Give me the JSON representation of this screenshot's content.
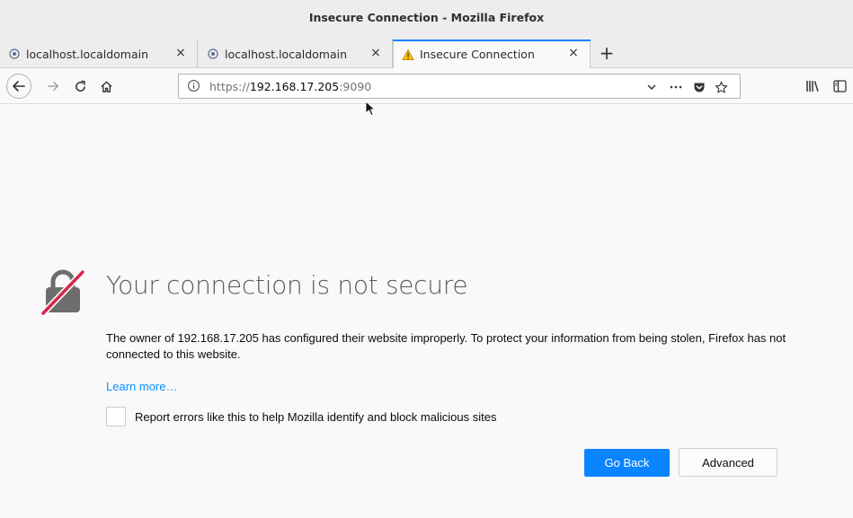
{
  "window": {
    "title": "Insecure Connection - Mozilla Firefox"
  },
  "tabs": [
    {
      "label": "localhost.localdomain",
      "close": "×",
      "icon": "cockpit-favicon"
    },
    {
      "label": "localhost.localdomain",
      "close": "×",
      "icon": "cockpit-favicon"
    },
    {
      "label": "Insecure Connection",
      "close": "×",
      "icon": "warning-triangle-icon",
      "active": true
    }
  ],
  "new_tab": "+",
  "urlbar": {
    "scheme": "https://",
    "host": "192.168.17.205",
    "port": ":9090"
  },
  "error": {
    "title": "Your connection is not secure",
    "description": "The owner of 192.168.17.205 has configured their website improperly. To protect your information from being stolen, Firefox has not connected to this website.",
    "learn_more": "Learn more…",
    "report_label": "Report errors like this to help Mozilla identify and block malicious sites",
    "go_back": "Go Back",
    "advanced": "Advanced"
  },
  "colors": {
    "accent": "#0a84ff",
    "warning": "#d7264c",
    "lock": "#6d6d6e",
    "link": "#0a8dff"
  }
}
